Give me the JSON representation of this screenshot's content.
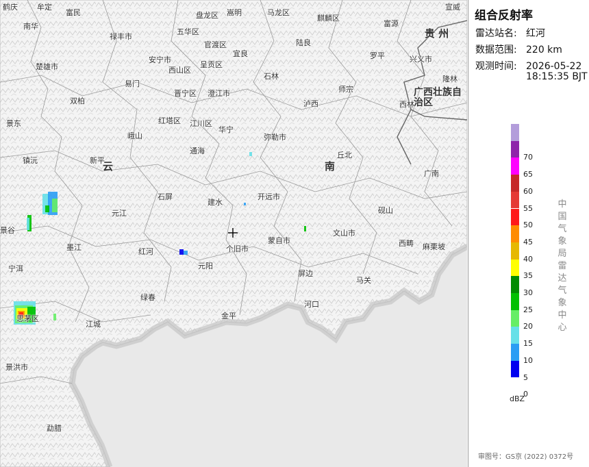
{
  "panel": {
    "title": "组合反射率",
    "station_label": "雷达站名:",
    "station_value": "红河",
    "range_label": "数据范围:",
    "range_value": "220 km",
    "time_label": "观测时间:",
    "time_date": "2026-05-22",
    "time_clock": "18:15:35 BJT",
    "legend": [
      {
        "label": "",
        "color": "#b39ddb"
      },
      {
        "label": "70",
        "color": "#8e24aa"
      },
      {
        "label": "65",
        "color": "#ff00ff"
      },
      {
        "label": "60",
        "color": "#c62828"
      },
      {
        "label": "55",
        "color": "#e53935"
      },
      {
        "label": "50",
        "color": "#ff1a1a"
      },
      {
        "label": "45",
        "color": "#ff8c00"
      },
      {
        "label": "40",
        "color": "#e6b800"
      },
      {
        "label": "35",
        "color": "#ffff00"
      },
      {
        "label": "30",
        "color": "#008c00"
      },
      {
        "label": "25",
        "color": "#00c000"
      },
      {
        "label": "20",
        "color": "#66ee66"
      },
      {
        "label": "15",
        "color": "#66e0e8"
      },
      {
        "label": "10",
        "color": "#2a9df4"
      },
      {
        "label": "5",
        "color": "#0000f0"
      },
      {
        "label": "0",
        "color": ""
      }
    ],
    "unit": "dBZ",
    "agency": "中国气象局雷达气象中心",
    "approval": "审图号：GS京 (2022) 0372号"
  },
  "map": {
    "regions": [
      {
        "id": "yun",
        "name": "云"
      },
      {
        "id": "nan",
        "name": "南"
      },
      {
        "id": "guizhou",
        "name": "贵 州"
      },
      {
        "id": "guangxi",
        "name": "广西壮族自治区"
      }
    ],
    "places": [
      {
        "id": "tai",
        "name": "鹤庆"
      },
      {
        "id": "mouding",
        "name": "牟定"
      },
      {
        "id": "fumin",
        "name": "富民"
      },
      {
        "id": "panlong",
        "name": "盘龙区"
      },
      {
        "id": "songming",
        "name": "嵩明"
      },
      {
        "id": "malong",
        "name": "马龙区"
      },
      {
        "id": "qilin",
        "name": "麒麟区"
      },
      {
        "id": "xuanwei",
        "name": "宣威"
      },
      {
        "id": "nanhua",
        "name": "南华"
      },
      {
        "id": "lufeng",
        "name": "禄丰市"
      },
      {
        "id": "wuhua",
        "name": "五华区"
      },
      {
        "id": "guandu",
        "name": "官渡区"
      },
      {
        "id": "fuyuan",
        "name": "富源"
      },
      {
        "id": "anning",
        "name": "安宁市"
      },
      {
        "id": "chenggong",
        "name": "呈贡区"
      },
      {
        "id": "yiliang",
        "name": "宜良"
      },
      {
        "id": "luliang",
        "name": "陆良"
      },
      {
        "id": "luoping",
        "name": "罗平"
      },
      {
        "id": "xingyi",
        "name": "兴义市"
      },
      {
        "id": "chuxiong",
        "name": "楚雄市"
      },
      {
        "id": "xishan",
        "name": "西山区"
      },
      {
        "id": "yimen",
        "name": "易门"
      },
      {
        "id": "jinning",
        "name": "晋宁区"
      },
      {
        "id": "chengjiang",
        "name": "澄江市"
      },
      {
        "id": "shilin",
        "name": "石林"
      },
      {
        "id": "shizong",
        "name": "师宗"
      },
      {
        "id": "longlin",
        "name": "隆林"
      },
      {
        "id": "shuangbai",
        "name": "双柏"
      },
      {
        "id": "hongta",
        "name": "红塔区"
      },
      {
        "id": "jiangchuan",
        "name": "江川区"
      },
      {
        "id": "luxi",
        "name": "泸西"
      },
      {
        "id": "xilin",
        "name": "西林"
      },
      {
        "id": "jingdong",
        "name": "景东"
      },
      {
        "id": "huaning",
        "name": "华宁"
      },
      {
        "id": "eshan",
        "name": "峨山"
      },
      {
        "id": "mile",
        "name": "弥勒市"
      },
      {
        "id": "tonghai",
        "name": "通海"
      },
      {
        "id": "qiubei",
        "name": "丘北"
      },
      {
        "id": "zhenyuan",
        "name": "镇沅"
      },
      {
        "id": "xinping",
        "name": "新平"
      },
      {
        "id": "guangnan",
        "name": "广南"
      },
      {
        "id": "shiping",
        "name": "石屏"
      },
      {
        "id": "jianshui",
        "name": "建水"
      },
      {
        "id": "kaiyuan",
        "name": "开远市"
      },
      {
        "id": "yanshan",
        "name": "砚山"
      },
      {
        "id": "jinggu",
        "name": "景谷"
      },
      {
        "id": "yuanjiang",
        "name": "元江"
      },
      {
        "id": "wenshan",
        "name": "文山市"
      },
      {
        "id": "mojiang",
        "name": "墨江"
      },
      {
        "id": "honghe",
        "name": "红河"
      },
      {
        "id": "gejiu",
        "name": "个旧市"
      },
      {
        "id": "mengzi",
        "name": "蒙自市"
      },
      {
        "id": "xichou",
        "name": "西畴"
      },
      {
        "id": "malipo",
        "name": "麻栗坡"
      },
      {
        "id": "ninger",
        "name": "宁洱"
      },
      {
        "id": "yuanyang",
        "name": "元阳"
      },
      {
        "id": "pingbian",
        "name": "屏边"
      },
      {
        "id": "maguan",
        "name": "马关"
      },
      {
        "id": "lvchun",
        "name": "绿春"
      },
      {
        "id": "hekou",
        "name": "河口"
      },
      {
        "id": "simao",
        "name": "思茅区"
      },
      {
        "id": "jiangcheng",
        "name": "江城"
      },
      {
        "id": "jinping",
        "name": "金平"
      },
      {
        "id": "jinghong",
        "name": "景洪市"
      },
      {
        "id": "mengla",
        "name": "勐腊"
      }
    ],
    "echo_colors": [
      "#66e0e8",
      "#2a9df4",
      "#00c000",
      "#66ee66",
      "#ffff00",
      "#e6b800",
      "#ff8c00",
      "#ff1a1a",
      "#0000f0"
    ]
  }
}
